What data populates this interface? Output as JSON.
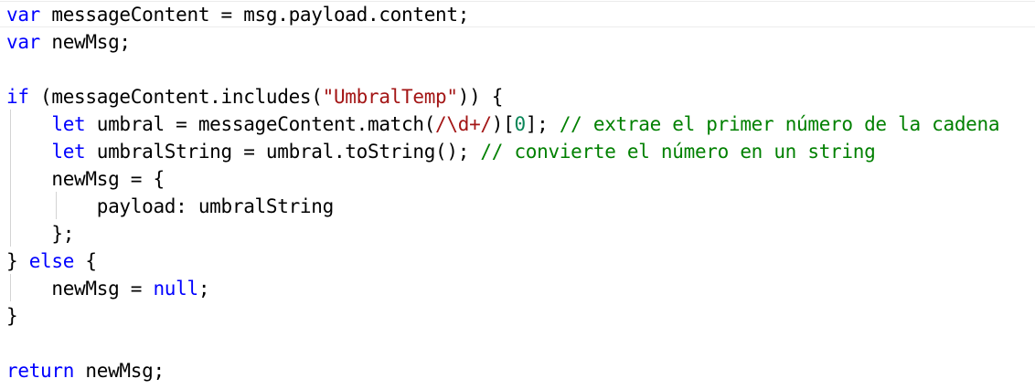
{
  "editor": {
    "lines": [
      {
        "tokens": [
          {
            "t": "var",
            "c": "kw"
          },
          {
            "t": " messageContent = msg.payload.content;",
            "c": ""
          }
        ]
      },
      {
        "tokens": [
          {
            "t": "var",
            "c": "kw"
          },
          {
            "t": " newMsg;",
            "c": ""
          }
        ]
      },
      {
        "tokens": []
      },
      {
        "tokens": [
          {
            "t": "if",
            "c": "kw"
          },
          {
            "t": " (messageContent.includes(",
            "c": ""
          },
          {
            "t": "\"UmbralTemp\"",
            "c": "str"
          },
          {
            "t": ")) {",
            "c": ""
          }
        ]
      },
      {
        "tokens": [
          {
            "t": "    ",
            "c": ""
          },
          {
            "t": "let",
            "c": "kw"
          },
          {
            "t": " umbral = messageContent.match(",
            "c": ""
          },
          {
            "t": "/\\d+/",
            "c": "str"
          },
          {
            "t": ")[",
            "c": ""
          },
          {
            "t": "0",
            "c": "num"
          },
          {
            "t": "]; ",
            "c": ""
          },
          {
            "t": "// extrae el primer número de la cadena",
            "c": "cm"
          }
        ]
      },
      {
        "tokens": [
          {
            "t": "    ",
            "c": ""
          },
          {
            "t": "let",
            "c": "kw"
          },
          {
            "t": " umbralString = umbral.toString(); ",
            "c": ""
          },
          {
            "t": "// convierte el número en un string",
            "c": "cm"
          }
        ]
      },
      {
        "tokens": [
          {
            "t": "    newMsg = {",
            "c": ""
          }
        ]
      },
      {
        "tokens": [
          {
            "t": "        payload: umbralString",
            "c": ""
          }
        ]
      },
      {
        "tokens": [
          {
            "t": "    };",
            "c": ""
          }
        ]
      },
      {
        "tokens": [
          {
            "t": "} ",
            "c": ""
          },
          {
            "t": "else",
            "c": "kw"
          },
          {
            "t": " {",
            "c": ""
          }
        ]
      },
      {
        "tokens": [
          {
            "t": "    newMsg = ",
            "c": ""
          },
          {
            "t": "null",
            "c": "kw"
          },
          {
            "t": ";",
            "c": ""
          }
        ]
      },
      {
        "tokens": [
          {
            "t": "}",
            "c": ""
          }
        ]
      },
      {
        "tokens": []
      },
      {
        "tokens": [
          {
            "t": "return",
            "c": "kw"
          },
          {
            "t": " newMsg;",
            "c": ""
          }
        ]
      }
    ]
  }
}
